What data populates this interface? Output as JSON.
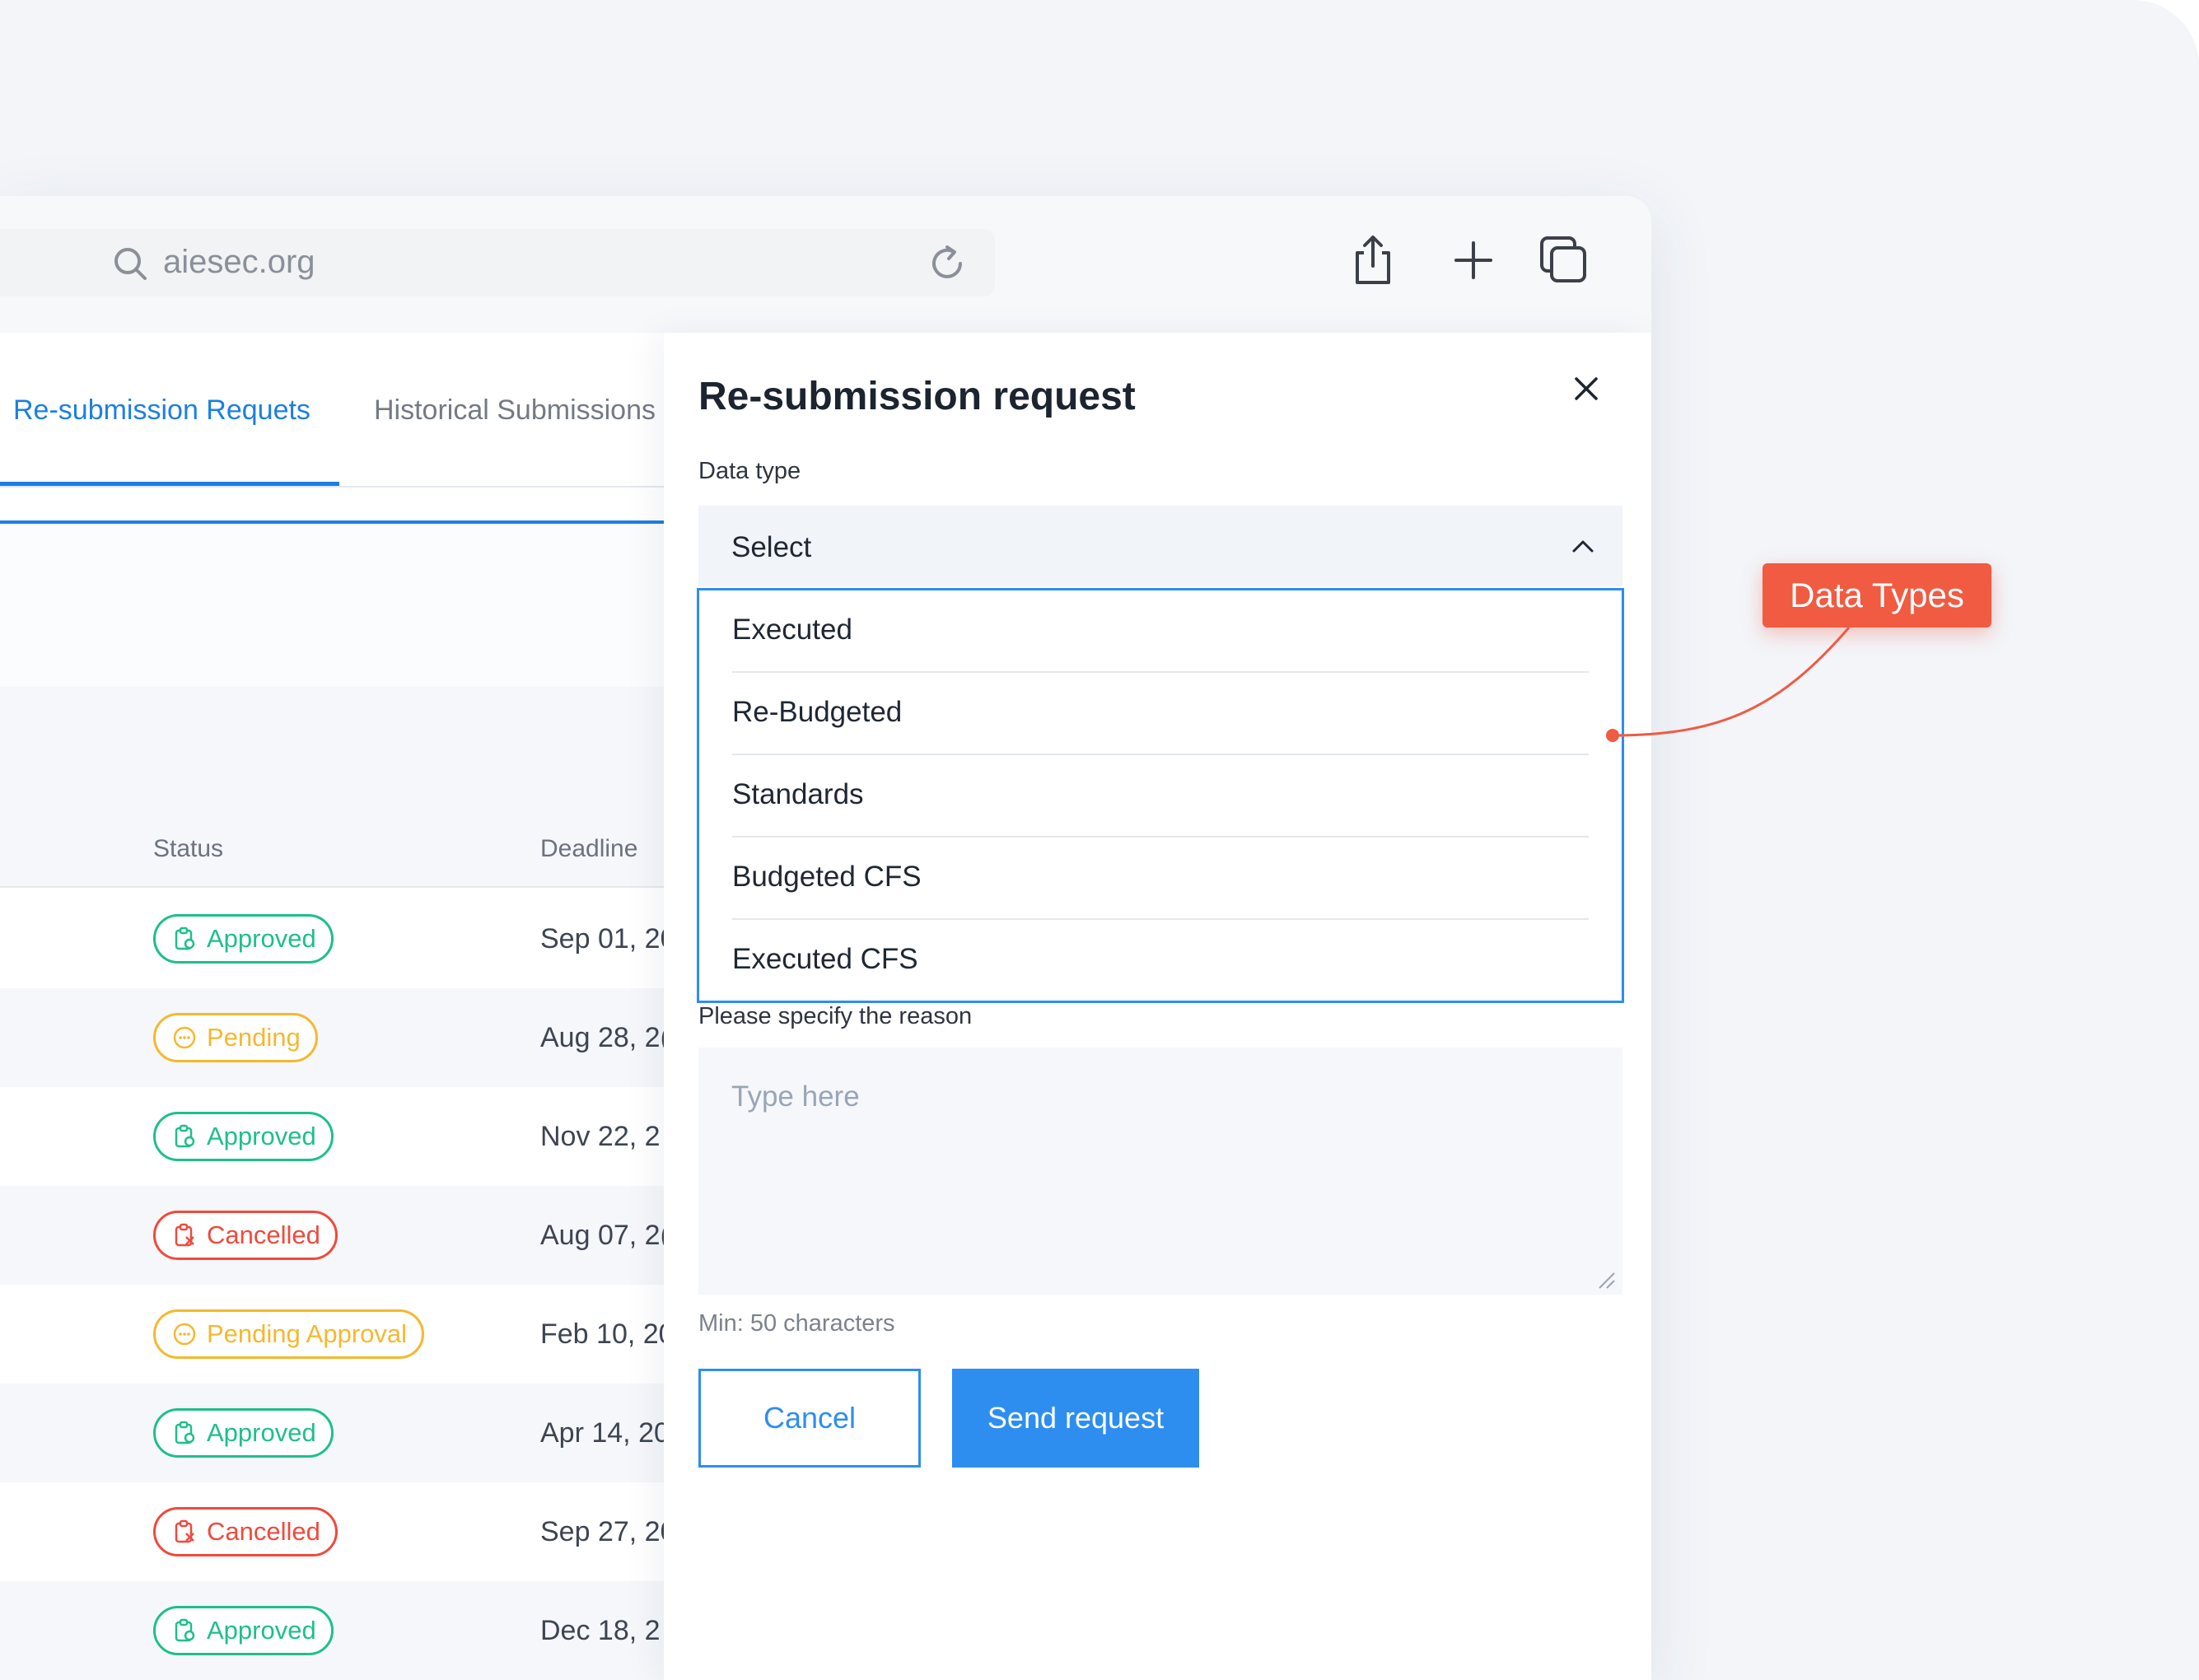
{
  "browser": {
    "url": "aiesec.org",
    "icons": [
      "search-icon",
      "reload-icon",
      "share-icon",
      "plus-icon",
      "tabs-icon"
    ]
  },
  "tabs": [
    {
      "label": "Re-submission Requets",
      "active": true
    },
    {
      "label": "Historical Submissions",
      "active": false
    }
  ],
  "table": {
    "headers": {
      "status": "Status",
      "deadline": "Deadline"
    },
    "rows": [
      {
        "status": "Approved",
        "kind": "approved",
        "deadline": "Sep 01, 20"
      },
      {
        "status": "Pending",
        "kind": "pending",
        "deadline": "Aug 28, 2("
      },
      {
        "status": "Approved",
        "kind": "approved",
        "deadline": "Nov 22, 2"
      },
      {
        "status": "Cancelled",
        "kind": "cancelled",
        "deadline": "Aug 07, 2("
      },
      {
        "status": "Pending Approval",
        "kind": "pending",
        "deadline": "Feb 10, 20"
      },
      {
        "status": "Approved",
        "kind": "approved",
        "deadline": "Apr 14, 20"
      },
      {
        "status": "Cancelled",
        "kind": "cancelled",
        "deadline": "Sep 27, 20"
      },
      {
        "status": "Approved",
        "kind": "approved",
        "deadline": "Dec 18, 2"
      }
    ]
  },
  "panel": {
    "title": "Re-submission request",
    "data_type_label": "Data type",
    "select_value": "Select",
    "options": [
      "Executed",
      "Re-Budgeted",
      "Standards",
      "Budgeted CFS",
      "Executed CFS"
    ],
    "reason_label": "Please specify the reason",
    "reason_placeholder": "Type here",
    "min_hint": "Min: 50 characters",
    "cancel_label": "Cancel",
    "send_label": "Send request"
  },
  "annotation": {
    "label": "Data Types"
  },
  "colors": {
    "accent": "#2d8ef0",
    "approved": "#1fbf8a",
    "pending": "#f5b82e",
    "cancelled": "#ef4a3c",
    "annotation": "#f05b42"
  }
}
